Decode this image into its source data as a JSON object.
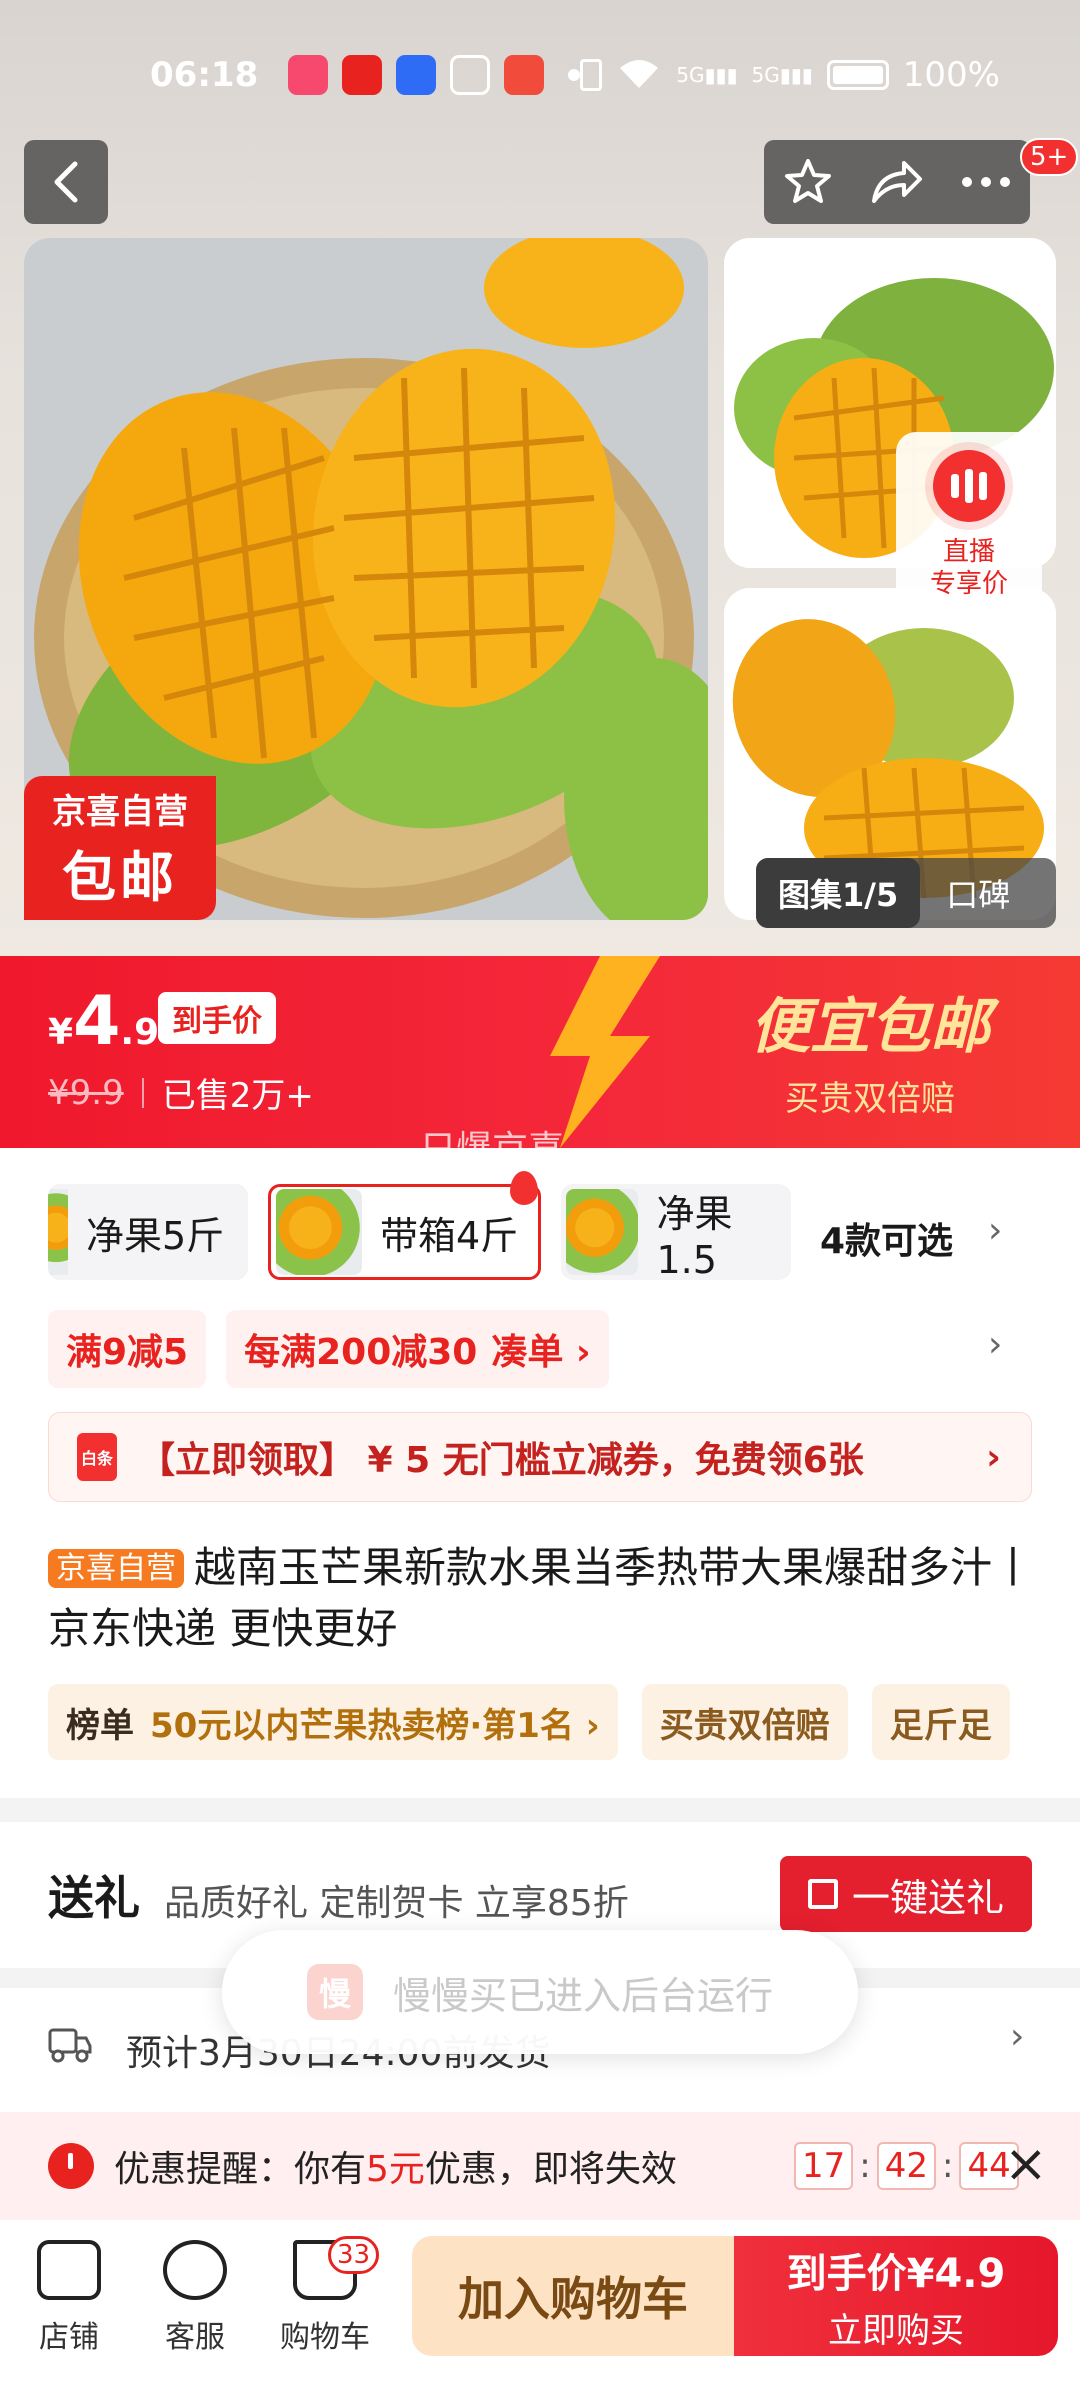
{
  "status_bar": {
    "time": "06:18",
    "battery": "100%",
    "network": "5G"
  },
  "nav": {
    "badge": "5+"
  },
  "gallery": {
    "counter": "图集1/5",
    "reviews": "口碑",
    "live_label": "直播\n专享价",
    "promo_badge_top": "京喜自营",
    "promo_badge_bottom": "包邮"
  },
  "price": {
    "currency": "¥",
    "integer": "4",
    "decimal": ".9",
    "tag": "到手价",
    "original": "¥9.9",
    "sold": "已售2万+",
    "slogan_main": "便宜包邮",
    "slogan_sub": "买贵双倍赔",
    "watermark": "只爆京喜"
  },
  "sku": {
    "options": [
      {
        "label": "净果5斤",
        "selected": false
      },
      {
        "label": "带箱4斤",
        "selected": true
      },
      {
        "label": "净果1.5",
        "selected": false
      }
    ],
    "count": "4款可选"
  },
  "promotions": {
    "items": [
      "满9减5",
      "每满200减30"
    ],
    "gather": "凑单 ›"
  },
  "coupon": {
    "icon": "白条",
    "text": "【立即领取】 ¥ 5 无门槛立减券，免费领6张"
  },
  "product": {
    "tag": "京喜自营",
    "title": "越南玉芒果新款水果当季热带大果爆甜多汁丨京东快递 更快更好"
  },
  "rank": {
    "label": "榜单",
    "text": "50元以内芒果热卖榜·第1名 ›",
    "tags": [
      "买贵双倍赔",
      "足斤足"
    ]
  },
  "gift": {
    "title": "送礼",
    "desc": "品质好礼 定制贺卡 立享85折",
    "button": "一键送礼"
  },
  "toast": {
    "icon": "慢",
    "text": "慢慢买已进入后台运行"
  },
  "shipping": {
    "text": "预计3月30日24:00前发货"
  },
  "reminder": {
    "prefix": "优惠提醒：你有",
    "amount": "5元",
    "suffix": "优惠，即将失效",
    "hours": "17",
    "minutes": "42",
    "seconds": "44"
  },
  "bottom": {
    "store": "店铺",
    "service": "客服",
    "cart": "购物车",
    "cart_count": "33",
    "add_to_cart": "加入购物车",
    "buy_price": "到手价¥4.9",
    "buy_now": "立即购买"
  }
}
